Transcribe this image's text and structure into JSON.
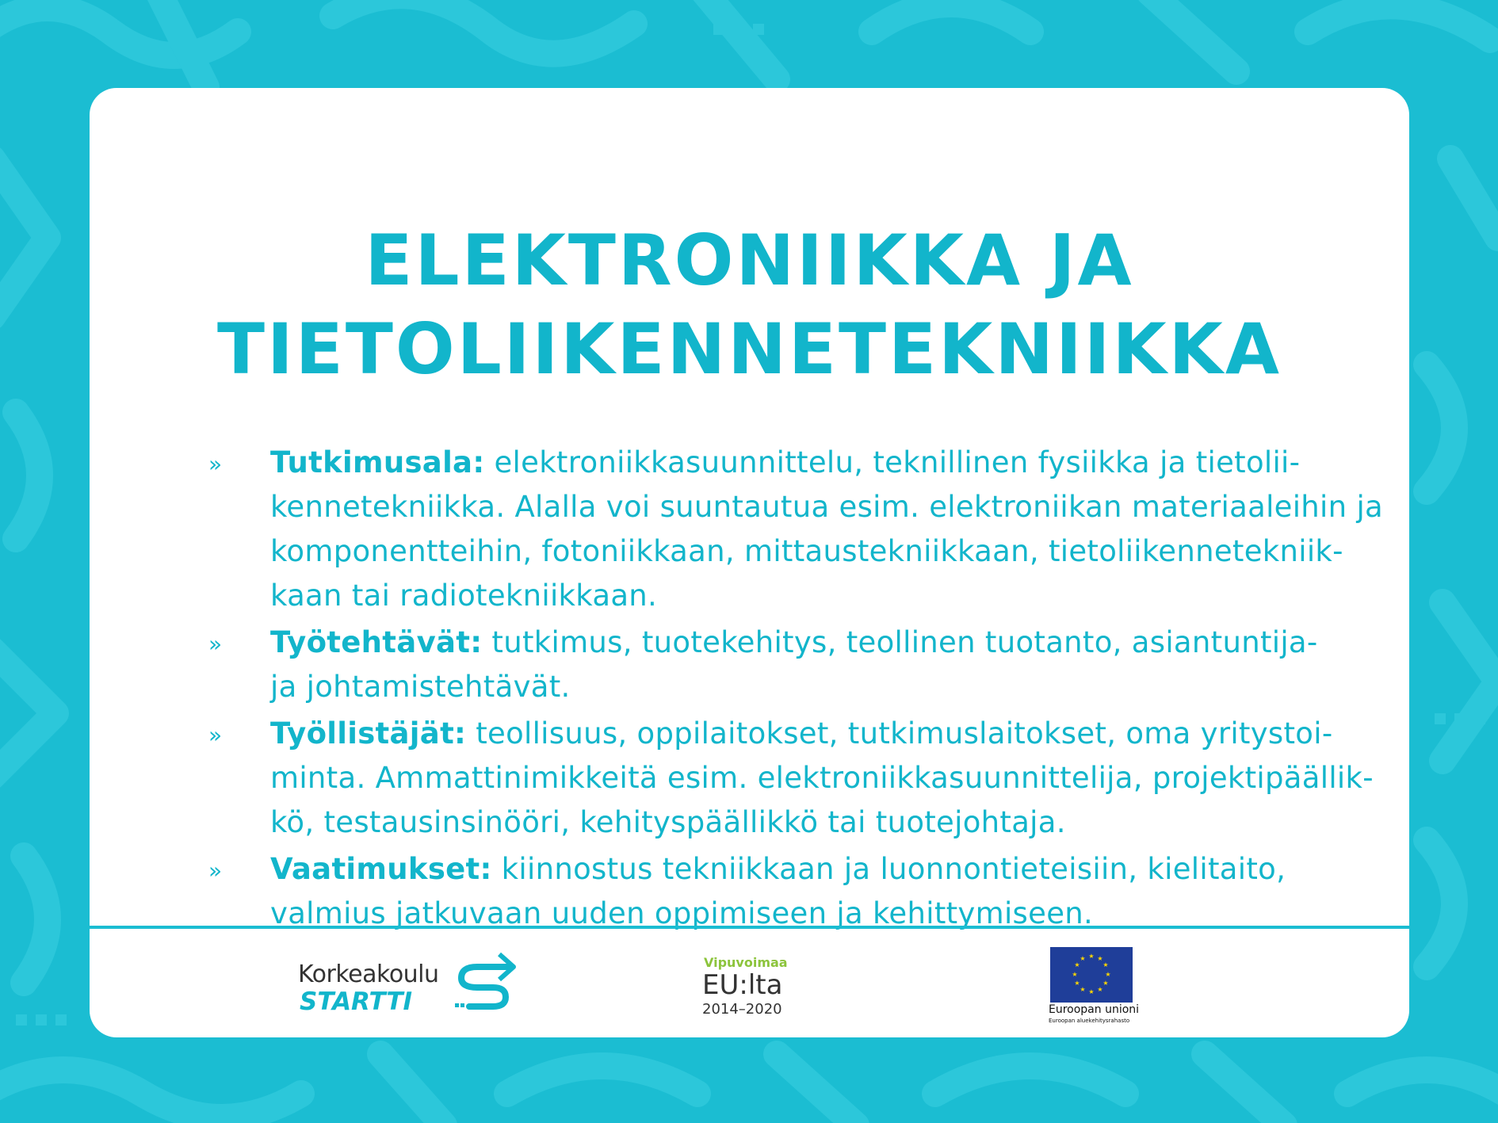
{
  "title": {
    "line1": "ELEKTRONIIKKA JA",
    "line2": "TIETOLIIKENNETEKNIIKKA"
  },
  "bullet_glyph": "»",
  "items": [
    {
      "label": "Tutkimusala:",
      "lines": [
        " elektroniikkasuunnittelu, teknillinen fysiikka ja tietolii-",
        "kennetekniikka. Alalla voi suuntautua esim. elektroniikan materiaaleihin ja",
        "komponentteihin, fotoniikkaan, mittaustekniikkaan, tietoliikennetekniik-",
        "kaan tai radiotekniikkaan."
      ]
    },
    {
      "label": "Työtehtävät:",
      "lines": [
        " tutkimus, tuotekehitys, teollinen tuotanto, asiantuntija-",
        "ja johtamistehtävät."
      ]
    },
    {
      "label": "Työllistäjät:",
      "lines": [
        " teollisuus, oppilaitokset, tutkimuslaitokset, oma yritystoi-",
        "minta. Ammattinimikkeitä esim. elektroniikkasuunnittelija, projektipäällik-",
        "kö, testausinsinööri, kehityspäällikkö tai tuotejohtaja."
      ]
    },
    {
      "label": "Vaatimukset:",
      "lines": [
        " kiinnostus tekniikkaan ja luonnontieteisiin, kielitaito,",
        "valmius jatkuvaan uuden oppimiseen ja kehittymiseen."
      ]
    }
  ],
  "footer": {
    "startti": {
      "top": "Korkeakoulu",
      "bottom": "STARTTI",
      "icon": "startti-s-arrow-icon"
    },
    "vipuvoimaa": {
      "top": "Vipuvoimaa",
      "middle": "EU:lta",
      "years": "2014–2020"
    },
    "eu": {
      "name": "Euroopan unioni",
      "fund": "Euroopan aluekehitysrahasto",
      "icon": "eu-flag-icon"
    }
  },
  "colors": {
    "brand_cyan": "#12b5cb",
    "background": "#1bbdd2",
    "vipuvoimaa_green": "#8cc43c",
    "eu_blue": "#1f3e99",
    "eu_star": "#ffd700"
  }
}
